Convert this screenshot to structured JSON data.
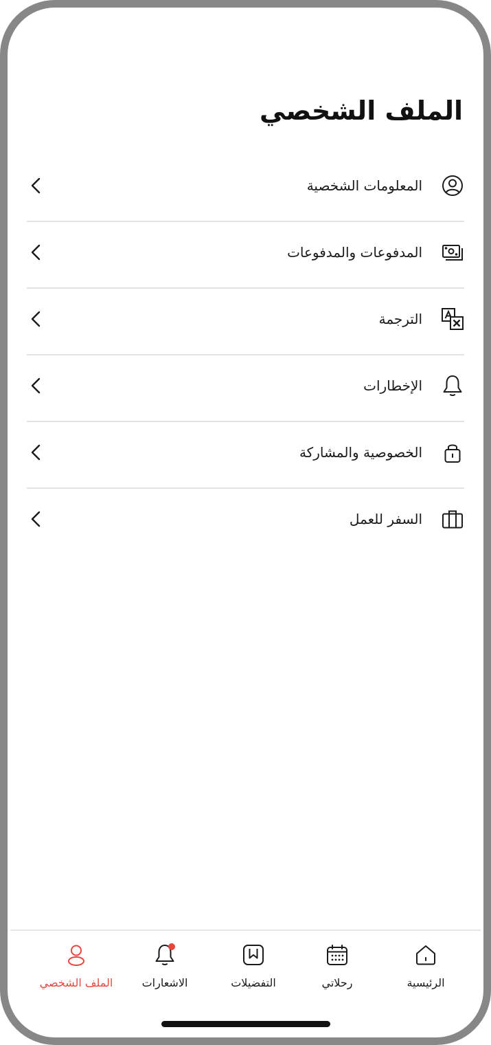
{
  "page": {
    "title": "الملف الشخصي"
  },
  "menu": {
    "items": [
      {
        "label": "المعلومات الشخصية",
        "icon": "user-circle-icon"
      },
      {
        "label": "المدفوعات والمدفوعات",
        "icon": "payments-icon"
      },
      {
        "label": "الترجمة",
        "icon": "translate-icon"
      },
      {
        "label": "الإخطارات",
        "icon": "bell-icon"
      },
      {
        "label": "الخصوصية والمشاركة",
        "icon": "lock-icon"
      },
      {
        "label": "السفر للعمل",
        "icon": "briefcase-icon"
      }
    ]
  },
  "tabs": [
    {
      "label": "الرئيسية",
      "icon": "home-icon",
      "active": false
    },
    {
      "label": "رحلاتي",
      "icon": "calendar-icon",
      "active": false
    },
    {
      "label": "التفضيلات",
      "icon": "bookmark-icon",
      "active": false
    },
    {
      "label": "الاشعارات",
      "icon": "bell-icon",
      "active": false,
      "badge": true
    },
    {
      "label": "الملف الشخصي",
      "icon": "user-icon",
      "active": true
    }
  ],
  "colors": {
    "accent": "#e8453c",
    "text": "#1a1a1a",
    "divider": "#e3e3e3",
    "frame": "#878787"
  }
}
